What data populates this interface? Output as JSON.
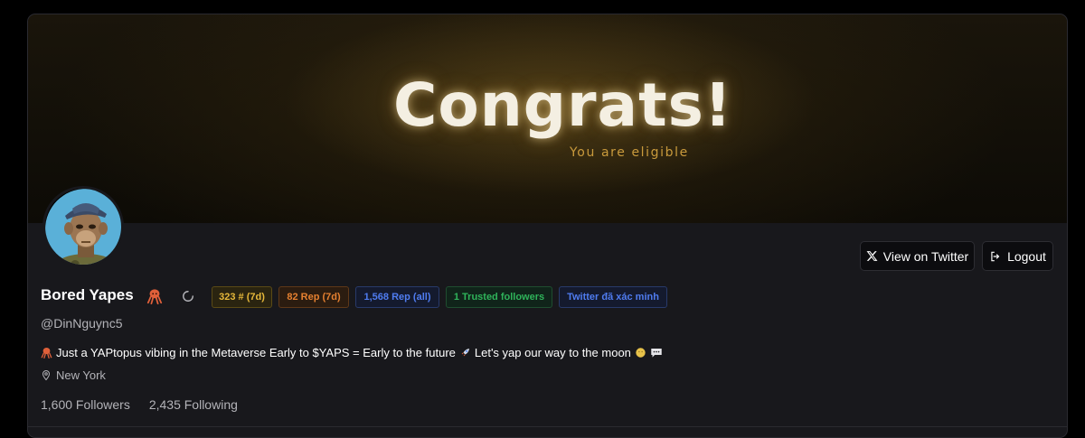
{
  "banner": {
    "title": "Congrats!",
    "subtitle": "You are eligible"
  },
  "actions": {
    "view_twitter_label": "View on Twitter",
    "logout_label": "Logout"
  },
  "profile": {
    "name": "Bored Yapes",
    "name_icon": "octopus-icon",
    "handle": "@DinNguync5",
    "bio": "Just a YAPtopus vibing in the Metaverse Early to $YAPS = Early to the future",
    "bio_tail": "Let's yap our way to the moon",
    "location": "New York",
    "followers_label": "1,600 Followers",
    "following_label": "2,435 Following"
  },
  "badges": [
    {
      "label": "323 # (7d)",
      "color": "#e6b83a"
    },
    {
      "label": "82 Rep (7d)",
      "color": "#e58030"
    },
    {
      "label": "1,568 Rep (all)",
      "color": "#4f7cf0"
    },
    {
      "label": "1 Trusted followers",
      "color": "#2fb35a"
    },
    {
      "label": "Twitter đã xác minh",
      "color": "#4f7cf0"
    }
  ]
}
